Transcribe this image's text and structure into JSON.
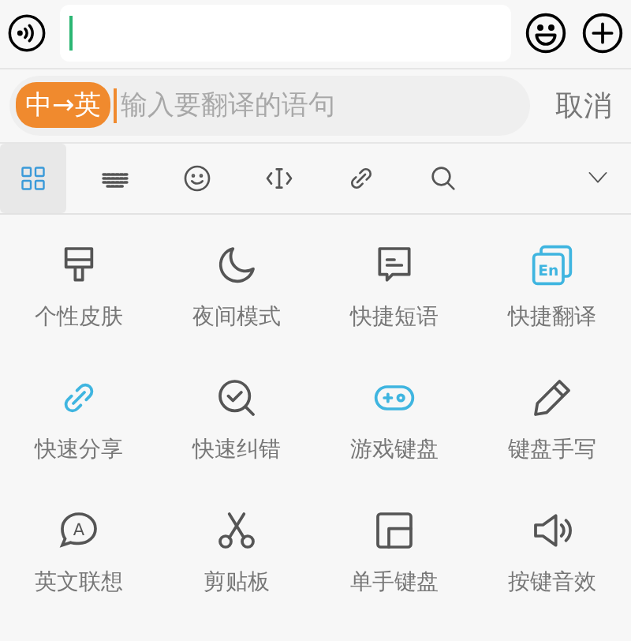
{
  "translate_bar": {
    "direction": "中→英",
    "placeholder": "输入要翻译的语句",
    "cancel": "取消"
  },
  "toolbar": [
    {
      "selected": true
    },
    {
      "selected": false
    },
    {
      "selected": false
    },
    {
      "selected": false
    },
    {
      "selected": false
    },
    {
      "selected": false
    }
  ],
  "features": [
    {
      "label": "个性皮肤",
      "highlighted": false
    },
    {
      "label": "夜间模式",
      "highlighted": false
    },
    {
      "label": "快捷短语",
      "highlighted": false
    },
    {
      "icon_text": "En",
      "label": "快捷翻译",
      "highlighted": true
    },
    {
      "label": "快速分享",
      "highlighted": true
    },
    {
      "label": "快速纠错",
      "highlighted": false
    },
    {
      "label": "游戏键盘",
      "highlighted": true
    },
    {
      "label": "键盘手写",
      "highlighted": false
    },
    {
      "icon_text": "A",
      "label": "英文联想",
      "highlighted": false
    },
    {
      "label": "剪贴板",
      "highlighted": false
    },
    {
      "label": "单手键盘",
      "highlighted": false
    },
    {
      "label": "按键音效",
      "highlighted": false
    }
  ]
}
